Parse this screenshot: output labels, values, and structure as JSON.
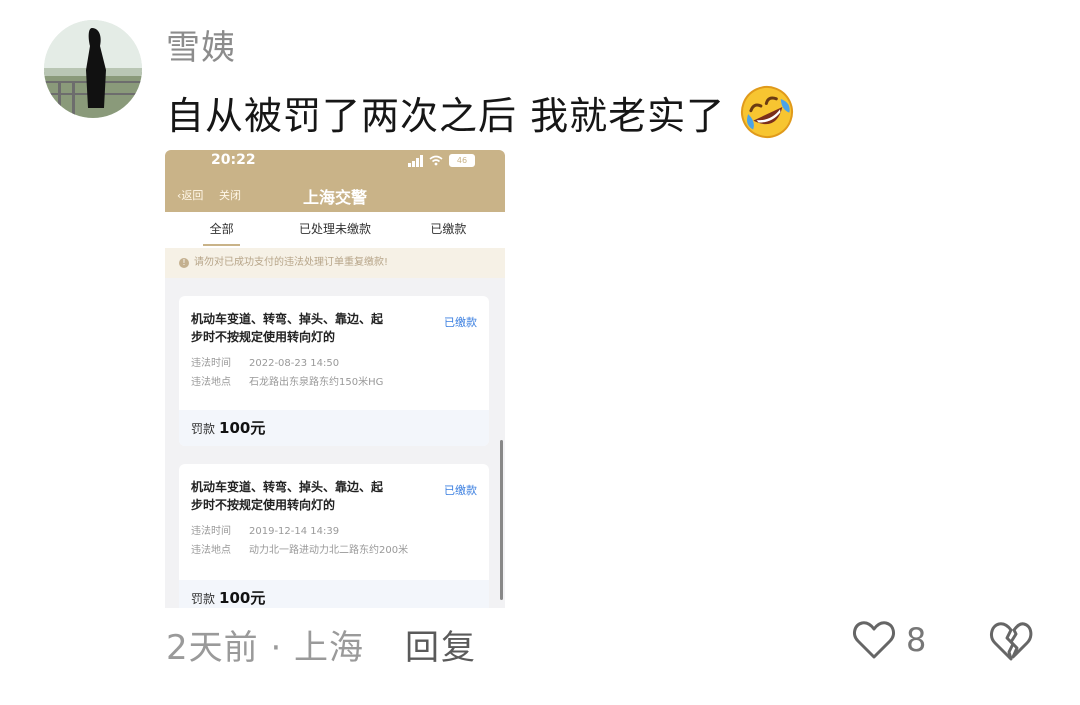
{
  "comment": {
    "username": "雪姨",
    "text": "自从被罚了两次之后 我就老实了",
    "emoji": "rolling-on-floor-laughing-emoji",
    "time_location": "2天前 · 上海",
    "reply_label": "回复",
    "like_count": "8"
  },
  "screenshot": {
    "status_time": "20:22",
    "battery": "46",
    "nav_back": "返回",
    "nav_close": "关闭",
    "nav_title": "上海交警",
    "tabs": [
      "全部",
      "已处理未缴款",
      "已缴款"
    ],
    "notice": "请勿对已成功支付的违法处理订单重复缴款!",
    "records": [
      {
        "desc_line1": "机动车变道、转弯、掉头、靠边、起",
        "desc_line2": "步时不按规定使用转向灯的",
        "status": "已缴款",
        "time_label": "违法时间",
        "time": "2022-08-23 14:50",
        "place_label": "违法地点",
        "place": "石龙路出东泉路东约150米HG",
        "fine_label": "罚款",
        "fine": "100元"
      },
      {
        "desc_line1": "机动车变道、转弯、掉头、靠边、起",
        "desc_line2": "步时不按规定使用转向灯的",
        "status": "已缴款",
        "time_label": "违法时间",
        "time": "2019-12-14 14:39",
        "place_label": "违法地点",
        "place": "动力北一路进动力北二路东约200米",
        "fine_label": "罚款",
        "fine": "100元"
      }
    ]
  },
  "colors": {
    "brand": "#c9b388",
    "paid": "#3b7fe0",
    "muted": "#9a9a9a"
  }
}
